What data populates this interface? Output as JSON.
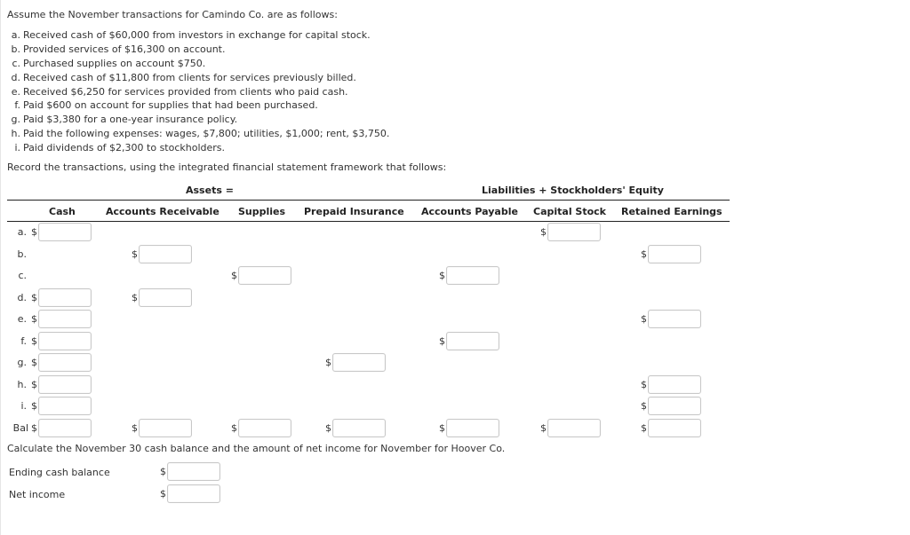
{
  "intro": "Assume the November transactions for Camindo Co. are as follows:",
  "transactions": [
    {
      "label": "a.",
      "text": "Received cash of $60,000 from investors in exchange for capital stock."
    },
    {
      "label": "b.",
      "text": "Provided services of $16,300 on account."
    },
    {
      "label": "c.",
      "text": "Purchased supplies on account $750."
    },
    {
      "label": "d.",
      "text": "Received cash of $11,800 from clients for services previously billed."
    },
    {
      "label": "e.",
      "text": "Received $6,250 for services provided from clients who paid cash."
    },
    {
      "label": "f.",
      "text": "Paid $600 on account for supplies that had been purchased."
    },
    {
      "label": "g.",
      "text": "Paid $3,380 for a one-year insurance policy."
    },
    {
      "label": "h.",
      "text": "Paid the following expenses: wages, $7,800; utilities, $1,000; rent, $3,750."
    },
    {
      "label": "i.",
      "text": "Paid dividends of $2,300 to stockholders."
    }
  ],
  "record_instruction": "Record the transactions, using the integrated financial statement framework that follows:",
  "table": {
    "group_headers": {
      "assets": "Assets =",
      "liabilities_equity": "Liabilities + Stockholders' Equity"
    },
    "columns": [
      "Cash",
      "Accounts Receivable",
      "Supplies",
      "Prepaid Insurance",
      "Accounts Payable",
      "Capital Stock",
      "Retained Earnings"
    ],
    "currency_symbol": "$",
    "rows": [
      {
        "label": "a.",
        "cells": [
          "",
          null,
          null,
          null,
          null,
          "",
          null
        ]
      },
      {
        "label": "b.",
        "cells": [
          null,
          "",
          null,
          null,
          null,
          null,
          ""
        ]
      },
      {
        "label": "c.",
        "cells": [
          null,
          null,
          "",
          null,
          "",
          null,
          null
        ]
      },
      {
        "label": "d.",
        "cells": [
          "",
          "",
          null,
          null,
          null,
          null,
          null
        ]
      },
      {
        "label": "e.",
        "cells": [
          "",
          null,
          null,
          null,
          null,
          null,
          ""
        ]
      },
      {
        "label": "f.",
        "cells": [
          "",
          null,
          null,
          null,
          "",
          null,
          null
        ]
      },
      {
        "label": "g.",
        "cells": [
          "",
          null,
          null,
          "",
          null,
          null,
          null
        ]
      },
      {
        "label": "h.",
        "cells": [
          "",
          null,
          null,
          null,
          null,
          null,
          ""
        ]
      },
      {
        "label": "i.",
        "cells": [
          "",
          null,
          null,
          null,
          null,
          null,
          ""
        ]
      },
      {
        "label": "Bal",
        "cells": [
          "",
          "",
          "",
          "",
          "",
          "",
          ""
        ]
      }
    ]
  },
  "calc_instruction": "Calculate the November 30 cash balance and the amount of net income for November for Hoover Co.",
  "results": [
    {
      "label": "Ending cash balance",
      "value": ""
    },
    {
      "label": "Net income",
      "value": ""
    }
  ]
}
